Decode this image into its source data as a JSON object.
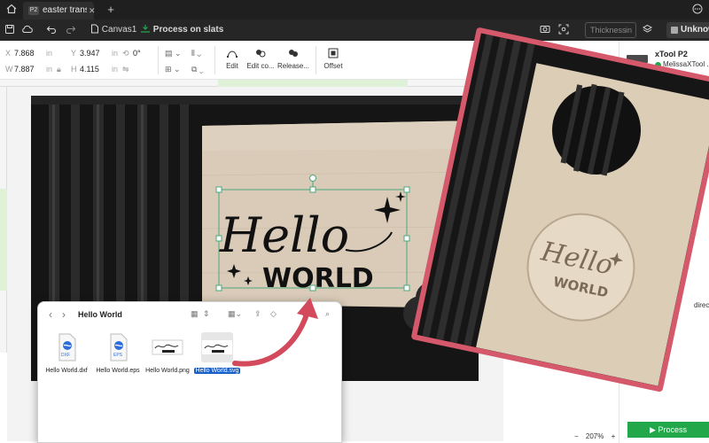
{
  "tabbar": {
    "tab_badge": "P2",
    "tab_title": "easter transf...",
    "new_tab": "+"
  },
  "toolbar": {
    "canvas_label": "Canvas1",
    "process_label": "Process on slats",
    "thickness_placeholder": "Thickness",
    "thickness_unit": "in",
    "device_label": "Unknown"
  },
  "properties": {
    "x_label": "X",
    "x_value": "7.868",
    "y_label": "Y",
    "y_value": "3.947",
    "w_label": "W",
    "w_value": "7.887",
    "h_label": "H",
    "h_value": "4.115",
    "unit": "in",
    "rotation": "0°"
  },
  "actions": {
    "edit": "Edit",
    "edit_contour": "Edit co...",
    "release": "Release...",
    "offset": "Offset"
  },
  "design": {
    "hello": "Hello",
    "world": "WORLD"
  },
  "right_panel": {
    "device_name": "xTool P2",
    "device_user": "MelissaXTool ...",
    "direct_text": "direct",
    "process_button": "Process",
    "zoom_value": "207%",
    "zoom_minus": "−",
    "zoom_plus": "+"
  },
  "finder": {
    "title": "Hello World",
    "files": [
      {
        "name": "Hello World.dxf",
        "badge": "DXF"
      },
      {
        "name": "Hello World.eps",
        "badge": "EPS"
      },
      {
        "name": "Hello World.png"
      },
      {
        "name": "Hello World.svg",
        "selected": true
      }
    ]
  },
  "overlay_photo": {
    "hello": "Hello",
    "world": "WORLD"
  },
  "colors": {
    "accent_green": "#22a84a",
    "overlay_frame": "#d5596a",
    "selection_blue": "#1a5fc7",
    "arrow_red": "#d24a5c"
  }
}
